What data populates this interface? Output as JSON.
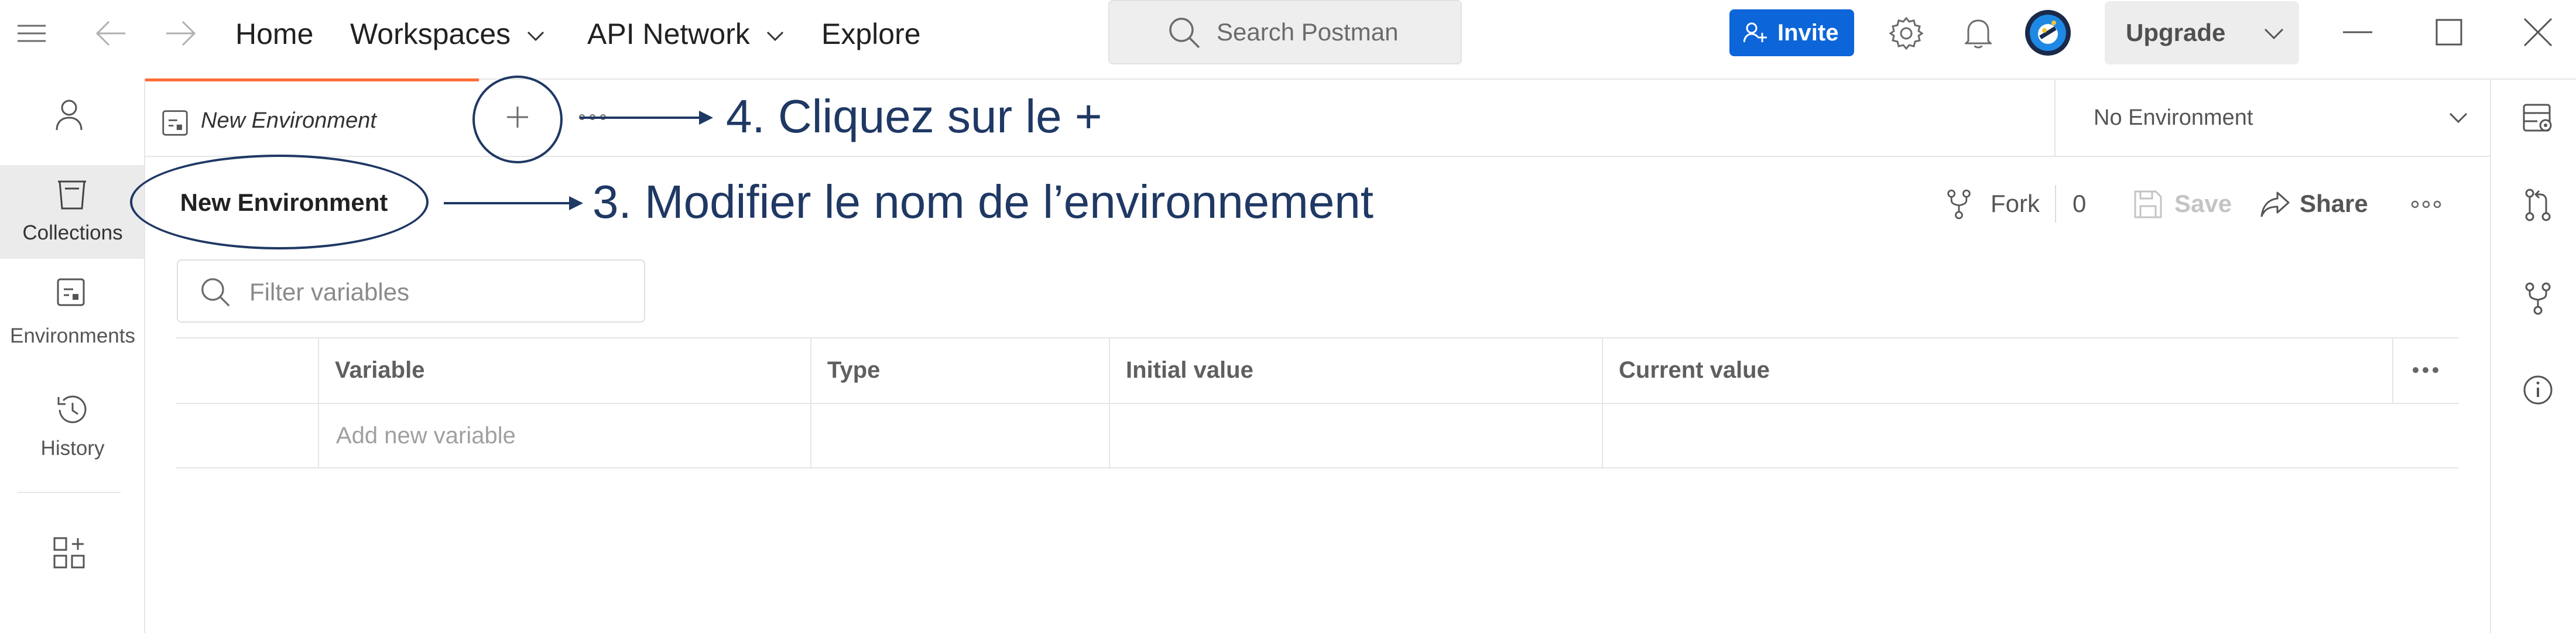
{
  "topbar": {
    "nav": {
      "home": "Home",
      "workspaces": "Workspaces",
      "api_network": "API Network",
      "explore": "Explore"
    },
    "search_placeholder": "Search Postman",
    "invite_label": "Invite",
    "upgrade_label": "Upgrade"
  },
  "sidebar": {
    "items": [
      {
        "label": "Collections",
        "icon": "trash-icon"
      },
      {
        "label": "Environments",
        "icon": "environment-icon"
      },
      {
        "label": "History",
        "icon": "history-icon"
      }
    ]
  },
  "tab": {
    "title": "New Environment"
  },
  "environment_selector": {
    "value": "No Environment"
  },
  "environment": {
    "name": "New Environment",
    "fork_label": "Fork",
    "fork_count": "0",
    "save_label": "Save",
    "share_label": "Share",
    "filter_placeholder": "Filter variables"
  },
  "table": {
    "headers": {
      "variable": "Variable",
      "type": "Type",
      "initial": "Initial value",
      "current": "Current value"
    },
    "new_row_placeholder": "Add new variable"
  },
  "annotations": {
    "step4": "4. Cliquez sur le +",
    "step3": "3. Modifier le nom de l’environnement"
  },
  "colors": {
    "accent_orange": "#ff6c37",
    "invite_blue": "#0c65d9",
    "annotation_navy": "#1f3864"
  }
}
